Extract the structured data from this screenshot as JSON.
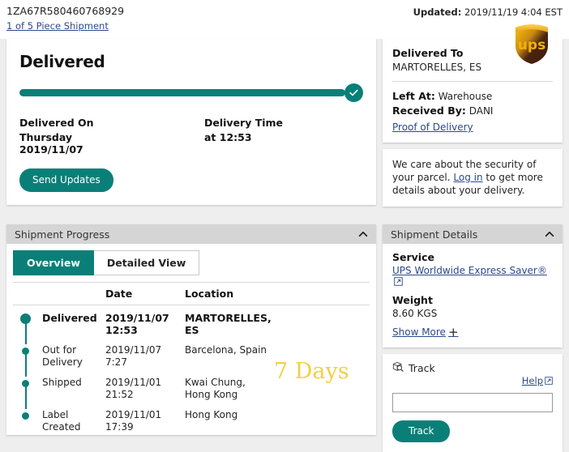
{
  "header": {
    "tracking_number": "1ZA67R580460768929",
    "piece_shipment_link": "1 of 5 Piece Shipment",
    "updated_label": "Updated:",
    "updated_value": "2019/11/19 4:04 EST",
    "logo_text": "ups"
  },
  "status": {
    "title": "Delivered",
    "delivered_on_label": "Delivered On",
    "delivered_on_day": "Thursday",
    "delivered_on_date": "2019/11/07",
    "delivery_time_label": "Delivery Time",
    "delivery_time_value": "at 12:53",
    "send_updates_label": "Send Updates",
    "progress_percent": 100
  },
  "delivered_to": {
    "title": "Delivered To",
    "address": "MARTORELLES, ES",
    "left_at_label": "Left At:",
    "left_at_value": "Warehouse",
    "received_by_label": "Received By:",
    "received_by_value": "DANI",
    "proof_of_delivery_link": "Proof of Delivery"
  },
  "security_notice": {
    "text_before": "We care about the security of your parcel. ",
    "link": "Log in",
    "text_after": " to get more details about your delivery."
  },
  "shipment_progress": {
    "panel_title": "Shipment Progress",
    "tabs": [
      {
        "label": "Overview",
        "active": true
      },
      {
        "label": "Detailed View",
        "active": false
      }
    ],
    "columns": [
      "",
      "Date",
      "Location"
    ],
    "rows": [
      {
        "status": "Delivered",
        "date": "2019/11/07",
        "time": "12:53",
        "location_line1": "MARTORELLES,",
        "location_line2": "ES",
        "current": true
      },
      {
        "status": "Out for",
        "status_line2": "Delivery",
        "date": "2019/11/07",
        "time": "7:27",
        "location_line1": "Barcelona, Spain",
        "location_line2": "",
        "current": false
      },
      {
        "status": "Shipped",
        "status_line2": "",
        "date": "2019/11/01",
        "time": "21:52",
        "location_line1": "Kwai Chung,",
        "location_line2": "Hong Kong",
        "current": false
      },
      {
        "status": "Label",
        "status_line2": "Created",
        "date": "2019/11/01",
        "time": "17:39",
        "location_line1": "Hong Kong",
        "location_line2": "",
        "current": false
      }
    ],
    "annotation": "7 Days"
  },
  "shipment_details": {
    "panel_title": "Shipment Details",
    "service_label": "Service",
    "service_value": "UPS Worldwide Express Saver®",
    "weight_label": "Weight",
    "weight_value": "8.60 KGS",
    "show_more_label": "Show More"
  },
  "track": {
    "title": "Track",
    "help_label": "Help",
    "input_value": "",
    "input_placeholder": "",
    "button_label": "Track"
  },
  "colors": {
    "teal": "#0a7f78",
    "link_blue": "#2b4a8b",
    "page_bg": "#eeeeee",
    "panel_header": "#d5d5d5",
    "annotation_yellow": "#f2d043",
    "ups_gold": "#ffb500",
    "ups_brown": "#35170c"
  }
}
